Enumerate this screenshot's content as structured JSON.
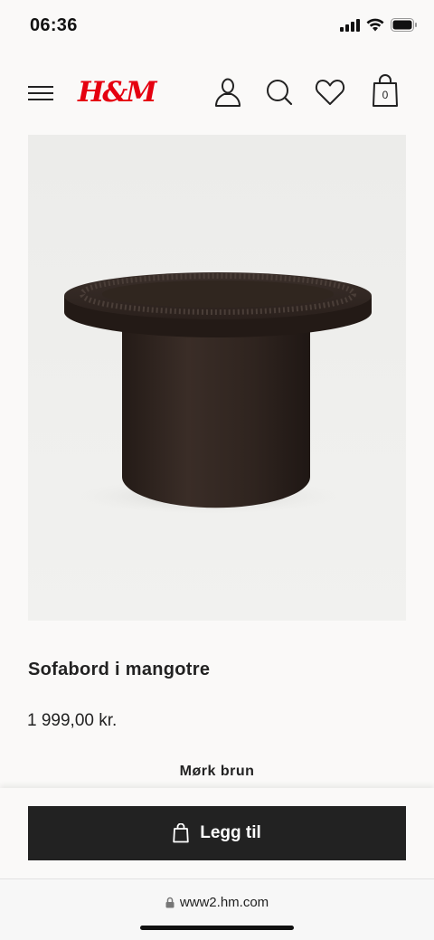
{
  "status_bar": {
    "time": "06:36"
  },
  "header": {
    "logo_text": "H&M",
    "menu_icon": "hamburger-icon",
    "account_icon": "account-icon",
    "search_icon": "search-icon",
    "favorites_icon": "heart-icon",
    "bag_icon": "shopping-bag-icon",
    "bag_count": "0"
  },
  "product": {
    "title": "Sofabord i mangotre",
    "price": "1 999,00 kr.",
    "color_name": "Mørk brun"
  },
  "actions": {
    "add_label": "Legg til",
    "add_icon": "shopping-bag-icon"
  },
  "browser": {
    "url": "www2.hm.com",
    "lock_icon": "lock-icon"
  },
  "colors": {
    "brand_red": "#e50010",
    "button_bg": "#222222",
    "page_bg": "#faf9f8",
    "product_wood": "#2e2420"
  }
}
